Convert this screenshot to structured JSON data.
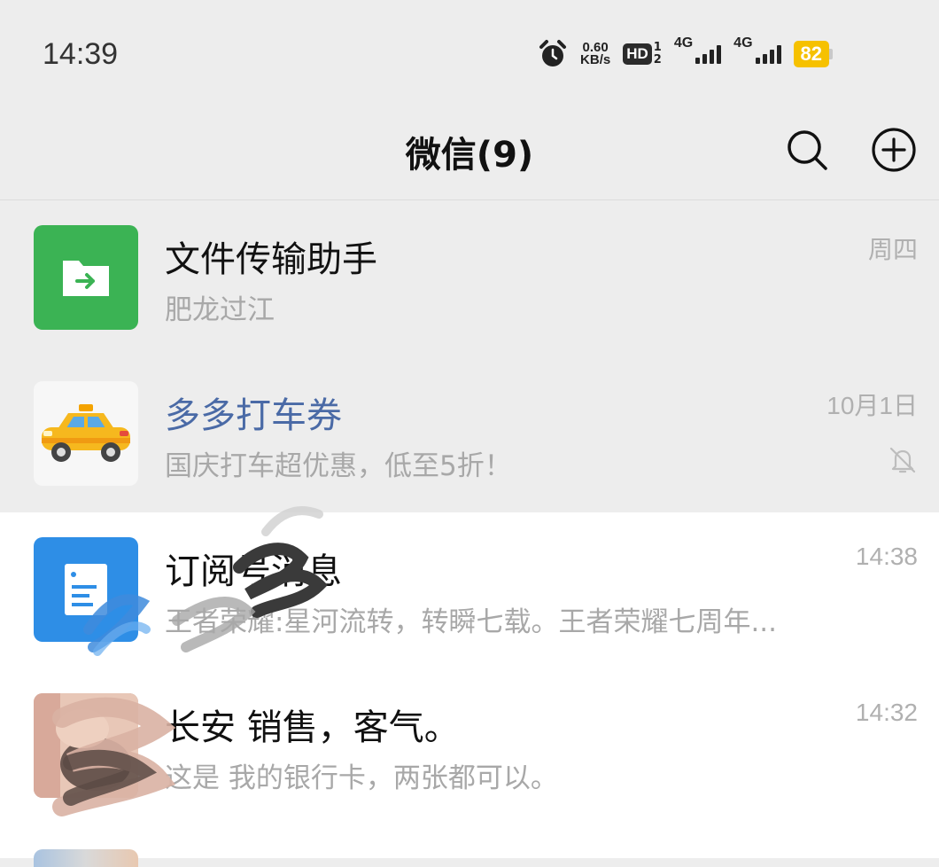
{
  "status_bar": {
    "time": "14:39",
    "net_speed_value": "0.60",
    "net_speed_unit": "KB/s",
    "hd_label": "HD",
    "hd_sim1": "1",
    "hd_sim2": "2",
    "sim1_label": "4G",
    "sim2_label": "4G",
    "battery": "82",
    "battery_color": "#f6c100"
  },
  "header": {
    "title": "微信(9)",
    "search_icon": "search-icon",
    "add_icon": "plus-circle-icon"
  },
  "chats": [
    {
      "name": "文件传输助手",
      "preview": "肥龙过江",
      "time": "周四",
      "avatar_icon": "folder-transfer-icon",
      "avatar_color": "#3bb354",
      "pinned": true,
      "muted": false
    },
    {
      "name": "多多打车券",
      "preview": "国庆打车超优惠，低至5折！",
      "time": "10月1日",
      "avatar_icon": "taxi-icon",
      "avatar_color": "#f7f7f7",
      "pinned": true,
      "muted": true,
      "name_color": "#4a6aa6"
    },
    {
      "name": "订阅号消息",
      "preview": "王者荣耀:星河流转，转瞬七载。王者荣耀七周年...",
      "time": "14:38",
      "avatar_icon": "subscription-doc-icon",
      "avatar_color": "#2e8ee6",
      "pinned": false,
      "muted": false
    },
    {
      "name": "长安  销售，客气。",
      "preview": "这是 我的银行卡，两张都可以。",
      "time": "14:32",
      "avatar_icon": "user-photo",
      "pinned": false,
      "muted": false
    }
  ]
}
